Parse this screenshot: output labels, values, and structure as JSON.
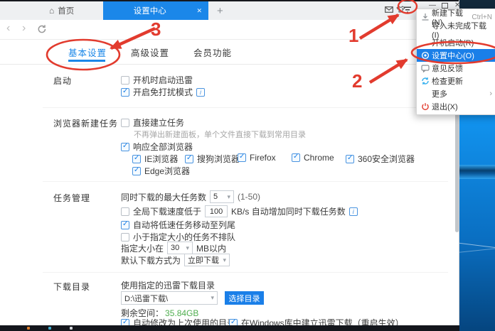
{
  "colors": {
    "accent_blue": "#1a87e8",
    "annotation_red": "#e23b2e",
    "free_space_green": "#4fae4f",
    "desktop_blue": "#0d84de"
  },
  "titlebar": {
    "home_tab": "首页",
    "active_tab": "设置中心",
    "tab_close": "✕",
    "new_tab": "+",
    "minimize": "—",
    "close": "✕"
  },
  "toolbar": {
    "back": "‹",
    "forward": "›"
  },
  "menu": {
    "items": [
      {
        "label": "新建下载(N)",
        "shortcut": "Ctrl+N"
      },
      {
        "label": "导入未完成下载(I)"
      },
      {
        "label": "开机启动(R)"
      },
      {
        "label": "设置中心(O)",
        "selected": true
      },
      {
        "label": "意见反馈"
      },
      {
        "label": "检查更新"
      },
      {
        "label": "更多",
        "submenu": "›"
      },
      {
        "label": "退出(X)"
      }
    ]
  },
  "settings": {
    "tabs": [
      {
        "label": "基本设置",
        "active": true
      },
      {
        "label": "高级设置"
      },
      {
        "label": "会员功能"
      }
    ],
    "startup": {
      "label": "启动",
      "cb_autostart": "开机时启动迅雷",
      "cb_dnd": "开启免打扰模式"
    },
    "browser_tasks": {
      "label": "浏览器新建任务",
      "cb_direct": "直接建立任务",
      "direct_note": "不再弹出新建面板，单个文件直接下载到常用目录",
      "cb_all_browsers": "响应全部浏览器",
      "browsers": [
        "IE浏览器",
        "搜狗浏览器",
        "Firefox",
        "Chrome",
        "360安全浏览器",
        "Edge浏览器"
      ]
    },
    "task_mgmt": {
      "label": "任务管理",
      "max_tasks_label": "同时下载的最大任务数",
      "max_tasks_value": "5",
      "max_tasks_range": "(1-50)",
      "speed_cb_label": "全局下载速度低于",
      "speed_value": "100",
      "speed_suffix": "KB/s 自动增加同时下载任务数",
      "cb_move_slow": "自动将低速任务移动至列尾",
      "cb_no_queue": "小于指定大小的任务不排队",
      "size_prefix": "指定大小在",
      "size_value": "30",
      "size_suffix": "MB以内",
      "default_mode_label": "默认下载方式为",
      "default_mode_value": "立即下载"
    },
    "download_dir": {
      "label": "下载目录",
      "use_dir_label": "使用指定的迅雷下载目录",
      "dir_value": "D:\\迅雷下载\\",
      "choose_btn": "选择目录",
      "space_label": "剩余空间：",
      "space_value": "35.84GB",
      "cb_last_dir": "自动修改为上次使用的目录",
      "cb_win_lib": "在Windows库中建立迅雷下载（重启生效）"
    }
  },
  "annotations": {
    "step1": "1",
    "step2": "2",
    "step3": "3"
  }
}
